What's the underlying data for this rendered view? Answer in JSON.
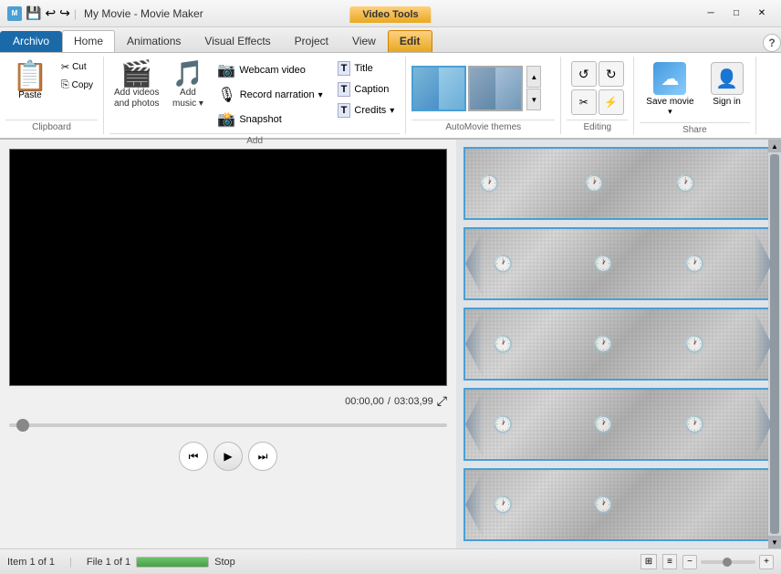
{
  "titlebar": {
    "app_title": "My Movie - Movie Maker",
    "video_tools": "Video Tools",
    "min_btn": "─",
    "max_btn": "□",
    "close_btn": "✕"
  },
  "ribbon": {
    "tabs": [
      "Archivo",
      "Home",
      "Animations",
      "Visual Effects",
      "Project",
      "View",
      "Edit"
    ],
    "active_tab": "Edit",
    "groups": {
      "clipboard": {
        "label": "Clipboard",
        "paste": "Paste",
        "cut": "✂ Cut",
        "copy": "⎘ Copy"
      },
      "add": {
        "label": "Add",
        "add_videos": "Add videos",
        "and_photos": "and photos",
        "add_music": "Add music",
        "webcam_video": "Webcam video",
        "record_narration": "Record narration",
        "snapshot": "Snapshot",
        "title": "Title",
        "caption": "Caption",
        "credits": "Credits"
      },
      "automovie": {
        "label": "AutoMovie themes"
      },
      "editing": {
        "label": "Editing",
        "label_text": "Editing"
      },
      "share": {
        "label": "Share",
        "save_movie": "Save movie",
        "sign_in": "Sign in"
      }
    }
  },
  "preview": {
    "time_current": "00:00,00",
    "time_total": "03:03,99",
    "expand_icon": "⤢"
  },
  "controls": {
    "prev": "⏮",
    "play": "▶",
    "next": "⏭"
  },
  "status": {
    "item": "Item 1 of 1",
    "file": "File 1 of 1",
    "stop": "Stop",
    "zoom_out": "−",
    "zoom_in": "+"
  },
  "icons": {
    "paste": "📋",
    "cut": "✂",
    "copy": "⎘",
    "videos": "🎬",
    "music": "🎵",
    "webcam": "📷",
    "narration": "🎙",
    "snapshot": "📸",
    "title": "T",
    "caption": "T",
    "credits": "T",
    "save": "☁",
    "person": "👤",
    "clock": "🕐"
  }
}
